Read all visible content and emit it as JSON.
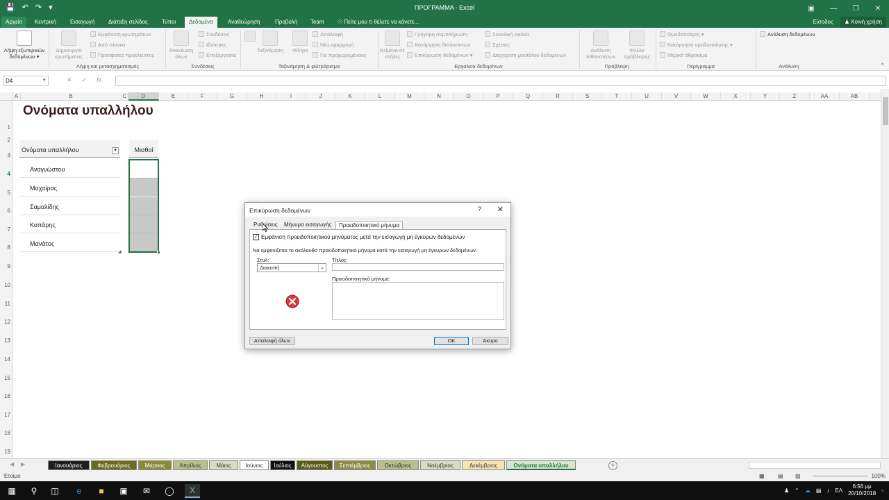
{
  "window": {
    "title": "ΠΡΟΓΡΑΜΜΑ - Excel"
  },
  "ribbon_tabs": {
    "items": [
      "Αρχείο",
      "Κεντρική",
      "Εισαγωγή",
      "Διάταξη σελίδας",
      "Τύποι",
      "Δεδομένα",
      "Αναθεώρηση",
      "Προβολή",
      "Team"
    ],
    "tell_me": "Πείτε μου τι θέλετε να κάνετε...",
    "signin": "Είσοδος",
    "share": "Κοινή χρήση"
  },
  "ribbon": {
    "get_external": "Λήψη εξωτερικών δεδομένων",
    "new_query": "Δημιουργία ερωτήματος",
    "show_queries": "Εμφάνιση ερωτημάτων",
    "from_table": "Από πίνακα",
    "recent_sources": "Πρόσφατες προελεύσεις",
    "group_get_transform": "Λήψη και μετασχηματισμός",
    "refresh_all": "Ανανέωση όλων",
    "connections": "Συνδέσεις",
    "properties": "Ιδιότητες",
    "edit_links": "Επεξεργασία",
    "group_connections": "Συνδέσεις",
    "sort": "Ταξινόμηση",
    "filter": "Φίλτρο",
    "clear": "Απαλοιφή",
    "reapply": "Νέα εφαρμογή",
    "advanced": "Για προχωρημένους",
    "group_sort_filter": "Ταξινόμηση & φιλτράρισμα",
    "text_to_columns": "Κείμενο σε στήλες",
    "flash_fill": "Γρήγορη συμπλήρωση",
    "remove_duplicates": "Κατάργηση διπλοτύπων",
    "data_validation": "Επικύρωση δεδομένων",
    "consolidate": "Συνολική εικόνα",
    "relationships": "Σχέσεις",
    "manage_model": "Διαχείριση μοντέλου δεδομένων",
    "group_data_tools": "Εργαλεία δεδομένων",
    "what_if": "Ανάλυση πιθανοτήτων",
    "forecast_sheet": "Φύλλο πρόβλεψης",
    "group_forecast": "Πρόβλεψη",
    "group_btn": "Ομαδοποίηση",
    "ungroup": "Κατάργηση ομαδοποίησης",
    "subtotal": "Μερικό άθροισμα",
    "group_outline": "Περίγραμμα",
    "data_analysis": "Ανάλυση δεδομένων",
    "group_analysis": "Ανάλυση"
  },
  "formula_bar": {
    "name_box": "D4",
    "fx": "fx"
  },
  "columns": [
    "A",
    "B",
    "C",
    "D",
    "E",
    "F",
    "G",
    "H",
    "I",
    "J",
    "K",
    "L",
    "M",
    "N",
    "O",
    "P",
    "Q",
    "R",
    "S",
    "T",
    "U",
    "V",
    "W",
    "X",
    "Y",
    "Z",
    "AA",
    "AB"
  ],
  "rows": [
    "1",
    "2",
    "3",
    "4",
    "5",
    "6",
    "7",
    "8",
    "9",
    "10",
    "11",
    "12",
    "13",
    "14",
    "15",
    "16",
    "17",
    "18",
    "19"
  ],
  "sheet": {
    "title": "Ονόματα υπαλλήλου",
    "header_names": "Ονόματα υπαλλήλου",
    "header_salary": "Μισθοί",
    "names": [
      "Αναγνώστου",
      "Μαχαίρας",
      "Σαμαλίδης",
      "Καπάρης",
      "Μανάτος"
    ]
  },
  "dialog": {
    "title": "Επικύρωση δεδομένων",
    "help": "?",
    "tabs": [
      "Ρυθμίσεις",
      "Μήνυμα εισαγωγής",
      "Προειδοποιητικό μήνυμα"
    ],
    "checkbox_label": "Εμφάνιση προειδοποιητικού μηνύματος μετά την εισαγωγή μη έγκυρων δεδομένων",
    "description": "Να εμφανίζεται το ακόλουθο προειδοποιητικό μήνυμα κατά την εισαγωγή μη έγκυρων δεδομένων:",
    "style_label": "Στυλ:",
    "style_value": "Διακοπή",
    "title_label": "Τίτλος:",
    "message_label": "Προειδοποιητικό μήνυμα:",
    "clear_all": "Απαλοιφή όλων",
    "ok": "OK",
    "cancel": "Άκυρο"
  },
  "sheet_tabs": [
    {
      "label": "Ιανουάριος",
      "bg": "#1f1f1f",
      "fg": "#ffffff"
    },
    {
      "label": "Φεβρουάριος",
      "bg": "#6b6b1e",
      "fg": "#ffffff"
    },
    {
      "label": "Μάρτιος",
      "bg": "#8a8a3c",
      "fg": "#ffffff"
    },
    {
      "label": "Απρίλιος",
      "bg": "#b8c08a",
      "fg": "#333333"
    },
    {
      "label": "Μάιος",
      "bg": "#d7dbc3",
      "fg": "#333333"
    },
    {
      "label": "Ιούνιος",
      "bg": "#ffffff",
      "fg": "#333333"
    },
    {
      "label": "Ιούλιος",
      "bg": "#111111",
      "fg": "#ffffff"
    },
    {
      "label": "Αύγουστος",
      "bg": "#5a5a1a",
      "fg": "#ffffff"
    },
    {
      "label": "Σεπτέμβριος",
      "bg": "#8c8c44",
      "fg": "#ffffff"
    },
    {
      "label": "Οκτώβριος",
      "bg": "#b8c08a",
      "fg": "#333333"
    },
    {
      "label": "Νοέμβριος",
      "bg": "#d7dbc3",
      "fg": "#333333"
    },
    {
      "label": "Δεκέμβριος",
      "bg": "#f5e6b0",
      "fg": "#333333"
    },
    {
      "label": "Ονόματα υπαλλήλου",
      "bg": "#d6e4d0",
      "fg": "#217346"
    }
  ],
  "status": {
    "text": "Έτοιμο",
    "zoom": "100%"
  },
  "taskbar": {
    "lang": "ΕΛ",
    "time": "6:56 μμ",
    "date": "20/10/2018"
  },
  "colors": {
    "excel_green": "#217346",
    "selection_fill": "#c8c8c8",
    "stop_red": "#d9363e"
  }
}
